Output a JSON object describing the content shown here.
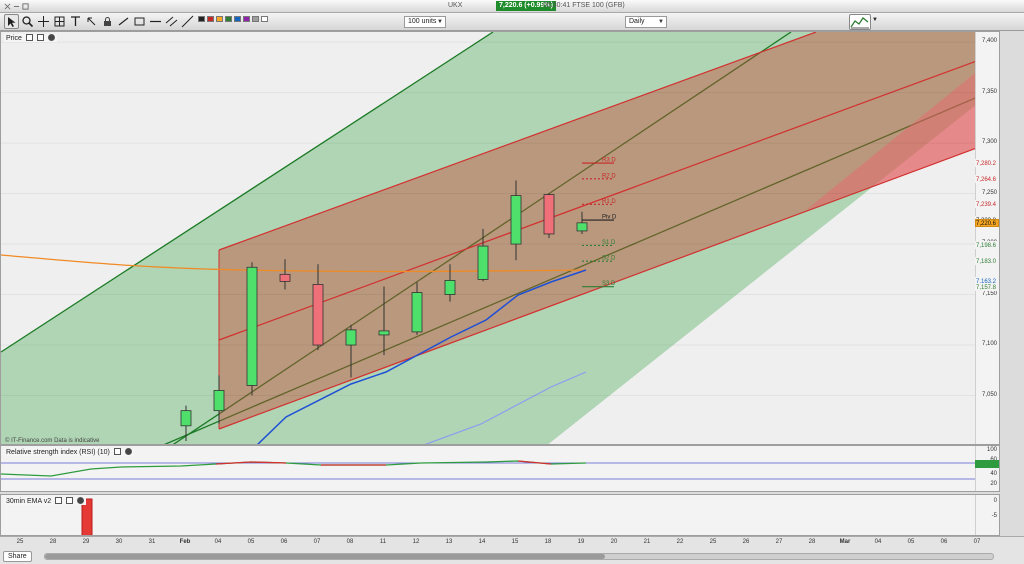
{
  "window": {
    "instrument": "UKX",
    "price": "7,220.6 (+0.99%)",
    "info": "06:30:41 FTSE 100 (GFB)"
  },
  "toolbar": {
    "units": "100 units",
    "interval": "Daily",
    "swatches": [
      "#222222",
      "#c62828",
      "#f9a825",
      "#2e7d32",
      "#1565c0",
      "#8e24aa",
      "#9e9e9e",
      "#ffffff"
    ]
  },
  "price_panel": {
    "label": "Price",
    "copyright": "© IT-Finance.com  Data is indicative",
    "y_ticks": [
      "7,400",
      "7,350",
      "7,300",
      "7,250",
      "7,200",
      "7,150",
      "7,100",
      "7,050"
    ],
    "price_tags": [
      {
        "text": "7,280.2",
        "color": "#c62828",
        "value": 7280.2
      },
      {
        "text": "7,264.6",
        "color": "#c62828",
        "value": 7264.6
      },
      {
        "text": "7,239.4",
        "color": "#c62828",
        "value": 7239.4
      },
      {
        "text": "7,223.8",
        "color": "#222222",
        "value": 7223.8
      },
      {
        "text": "7,220.6",
        "color": "#f5a623",
        "value": 7220.6
      },
      {
        "text": "7,198.6",
        "color": "#2e7d32",
        "value": 7198.6
      },
      {
        "text": "7,183.0",
        "color": "#2e7d32",
        "value": 7183.0
      },
      {
        "text": "7,163.2",
        "color": "#1565c0",
        "value": 7163.2
      },
      {
        "text": "7,157.8",
        "color": "#2e7d32",
        "value": 7157.8
      }
    ],
    "pivots": [
      {
        "label": "R3 D",
        "value": 7280.2,
        "color": "#c62828"
      },
      {
        "label": "R2 D",
        "value": 7264.6,
        "color": "#c62828"
      },
      {
        "label": "R1 D",
        "value": 7239.4,
        "color": "#c62828"
      },
      {
        "label": "Piv D",
        "value": 7223.8,
        "color": "#222222"
      },
      {
        "label": "S1 D",
        "value": 7198.6,
        "color": "#2e7d32"
      },
      {
        "label": "S2 D",
        "value": 7183.0,
        "color": "#2e7d32"
      },
      {
        "label": "S3 D",
        "value": 7157.8,
        "color": "#2e7d32"
      }
    ]
  },
  "rsi_panel": {
    "label": "Relative strength index (RSI) (10)",
    "y_ticks": [
      "100",
      "60",
      "40",
      "20"
    ]
  },
  "ema_panel": {
    "label": "30min EMA v2",
    "y_ticks": [
      "0",
      "-5"
    ]
  },
  "footer": {
    "share_label": "Share",
    "dates": [
      "25",
      "28",
      "29",
      "30",
      "31",
      "Feb",
      "04",
      "05",
      "06",
      "07",
      "08",
      "11",
      "12",
      "13",
      "14",
      "15",
      "18",
      "19",
      "20",
      "21",
      "22",
      "25",
      "26",
      "27",
      "28",
      "Mar",
      "04",
      "05",
      "06",
      "07"
    ]
  },
  "chart_data": {
    "type": "candlestick",
    "ylim": [
      7000,
      7410
    ],
    "x": [
      "24",
      "25",
      "28",
      "29",
      "30",
      "31",
      "Feb 01",
      "04",
      "05",
      "06",
      "07",
      "08",
      "11",
      "12",
      "13",
      "14",
      "15",
      "18",
      "19"
    ],
    "candles": [
      {
        "date": "Feb 01",
        "open": 7020,
        "high": 7040,
        "low": 7005,
        "close": 7035
      },
      {
        "date": "04",
        "open": 7035,
        "high": 7070,
        "low": 7022,
        "close": 7055
      },
      {
        "date": "05",
        "open": 7060,
        "high": 7182,
        "low": 7050,
        "close": 7177
      },
      {
        "date": "06",
        "open": 7170,
        "high": 7185,
        "low": 7155,
        "close": 7163
      },
      {
        "date": "07",
        "open": 7160,
        "high": 7180,
        "low": 7095,
        "close": 7100
      },
      {
        "date": "08",
        "open": 7100,
        "high": 7120,
        "low": 7068,
        "close": 7115
      },
      {
        "date": "11",
        "open": 7110,
        "high": 7158,
        "low": 7090,
        "close": 7114
      },
      {
        "date": "12",
        "open": 7113,
        "high": 7162,
        "low": 7110,
        "close": 7152
      },
      {
        "date": "13",
        "open": 7150,
        "high": 7180,
        "low": 7143,
        "close": 7164
      },
      {
        "date": "14",
        "open": 7165,
        "high": 7215,
        "low": 7163,
        "close": 7198
      },
      {
        "date": "15",
        "open": 7200,
        "high": 7263,
        "low": 7184,
        "close": 7248
      },
      {
        "date": "18",
        "open": 7249,
        "high": 7250,
        "low": 7206,
        "close": 7210
      },
      {
        "date": "19",
        "open": 7213,
        "high": 7232,
        "low": 7210,
        "close": 7221
      }
    ]
  }
}
